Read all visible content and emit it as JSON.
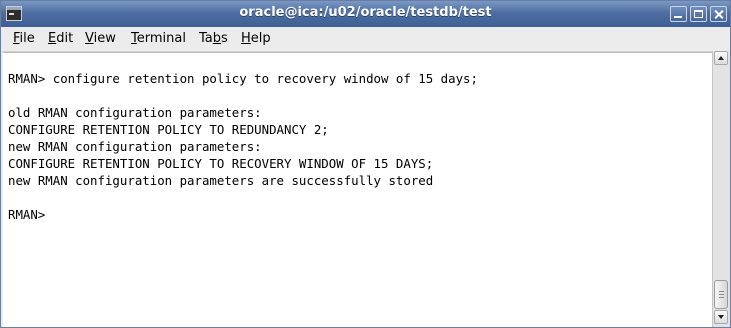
{
  "window": {
    "title": "oracle@ica:/u02/oracle/testdb/test",
    "icons": {
      "app": "terminal-icon",
      "minimize": "minimize-icon",
      "maximize": "maximize-icon",
      "close": "close-icon"
    }
  },
  "menu": {
    "items": [
      {
        "mnemonic": "F",
        "rest": "ile"
      },
      {
        "mnemonic": "E",
        "rest": "dit"
      },
      {
        "mnemonic": "V",
        "rest": "iew"
      },
      {
        "mnemonic": "T",
        "rest": "erminal"
      },
      {
        "pre": "Ta",
        "mnemonic": "b",
        "rest": "s"
      },
      {
        "mnemonic": "H",
        "rest": "elp"
      }
    ]
  },
  "terminal": {
    "lines": [
      "RMAN> configure retention policy to recovery window of 15 days;",
      "",
      "old RMAN configuration parameters:",
      "CONFIGURE RETENTION POLICY TO REDUNDANCY 2;",
      "new RMAN configuration parameters:",
      "CONFIGURE RETENTION POLICY TO RECOVERY WINDOW OF 15 DAYS;",
      "new RMAN configuration parameters are successfully stored",
      "",
      "RMAN>"
    ]
  },
  "scrollbar": {
    "up_icon": "arrow-up-icon",
    "down_icon": "arrow-down-icon",
    "scroll_position": 1.0
  }
}
